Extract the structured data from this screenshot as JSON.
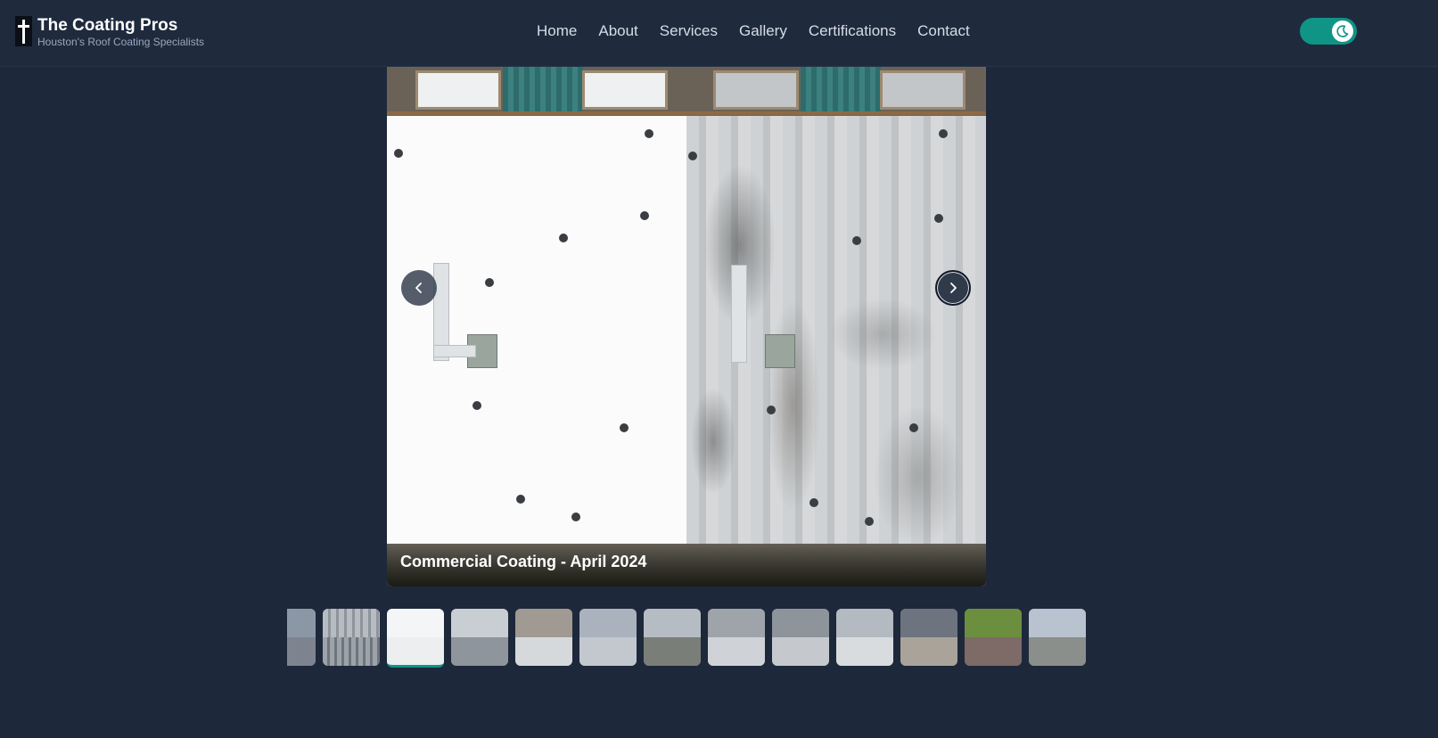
{
  "brand": {
    "title": "The Coating Pros",
    "subtitle": "Houston's Roof Coating Specialists",
    "logo_icon": "cross-icon"
  },
  "nav": {
    "items": [
      {
        "label": "Home"
      },
      {
        "label": "About"
      },
      {
        "label": "Services"
      },
      {
        "label": "Gallery"
      },
      {
        "label": "Certifications"
      },
      {
        "label": "Contact"
      }
    ]
  },
  "theme_toggle": {
    "icon": "moon-icon",
    "state": "dark",
    "accent_color": "#0f9486"
  },
  "gallery": {
    "caption": "Commercial Coating - April 2024",
    "prev_icon": "chevron-left-icon",
    "next_icon": "chevron-right-icon",
    "thumbnail_count": 13,
    "active_thumbnail": 3
  },
  "colors": {
    "background": "#1e283b",
    "header": "#1f2a3d",
    "accent": "#0f9486"
  }
}
